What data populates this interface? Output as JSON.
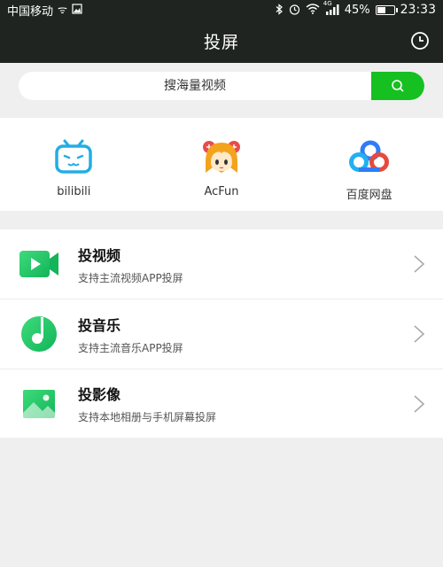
{
  "status_bar": {
    "carrier": "中国移动",
    "network": "4G",
    "battery_text": "45%",
    "battery_level": 0.45,
    "time": "23:33"
  },
  "header": {
    "title": "投屏"
  },
  "search": {
    "placeholder": "搜海量视频"
  },
  "apps": [
    {
      "label": "bilibili",
      "icon": "bilibili-icon"
    },
    {
      "label": "AcFun",
      "icon": "acfun-icon"
    },
    {
      "label": "百度网盘",
      "icon": "baidu-netdisk-icon"
    }
  ],
  "features": [
    {
      "title": "投视频",
      "subtitle": "支持主流视频APP投屏",
      "icon": "video-camera-icon"
    },
    {
      "title": "投音乐",
      "subtitle": "支持主流音乐APP投屏",
      "icon": "music-note-icon"
    },
    {
      "title": "投影像",
      "subtitle": "支持本地相册与手机屏幕投屏",
      "icon": "image-icon"
    }
  ],
  "colors": {
    "accent_green": "#16c021",
    "header_bg": "#1f2420",
    "bilibili_blue": "#23ade5",
    "baidu_blue": "#2f7df6"
  }
}
